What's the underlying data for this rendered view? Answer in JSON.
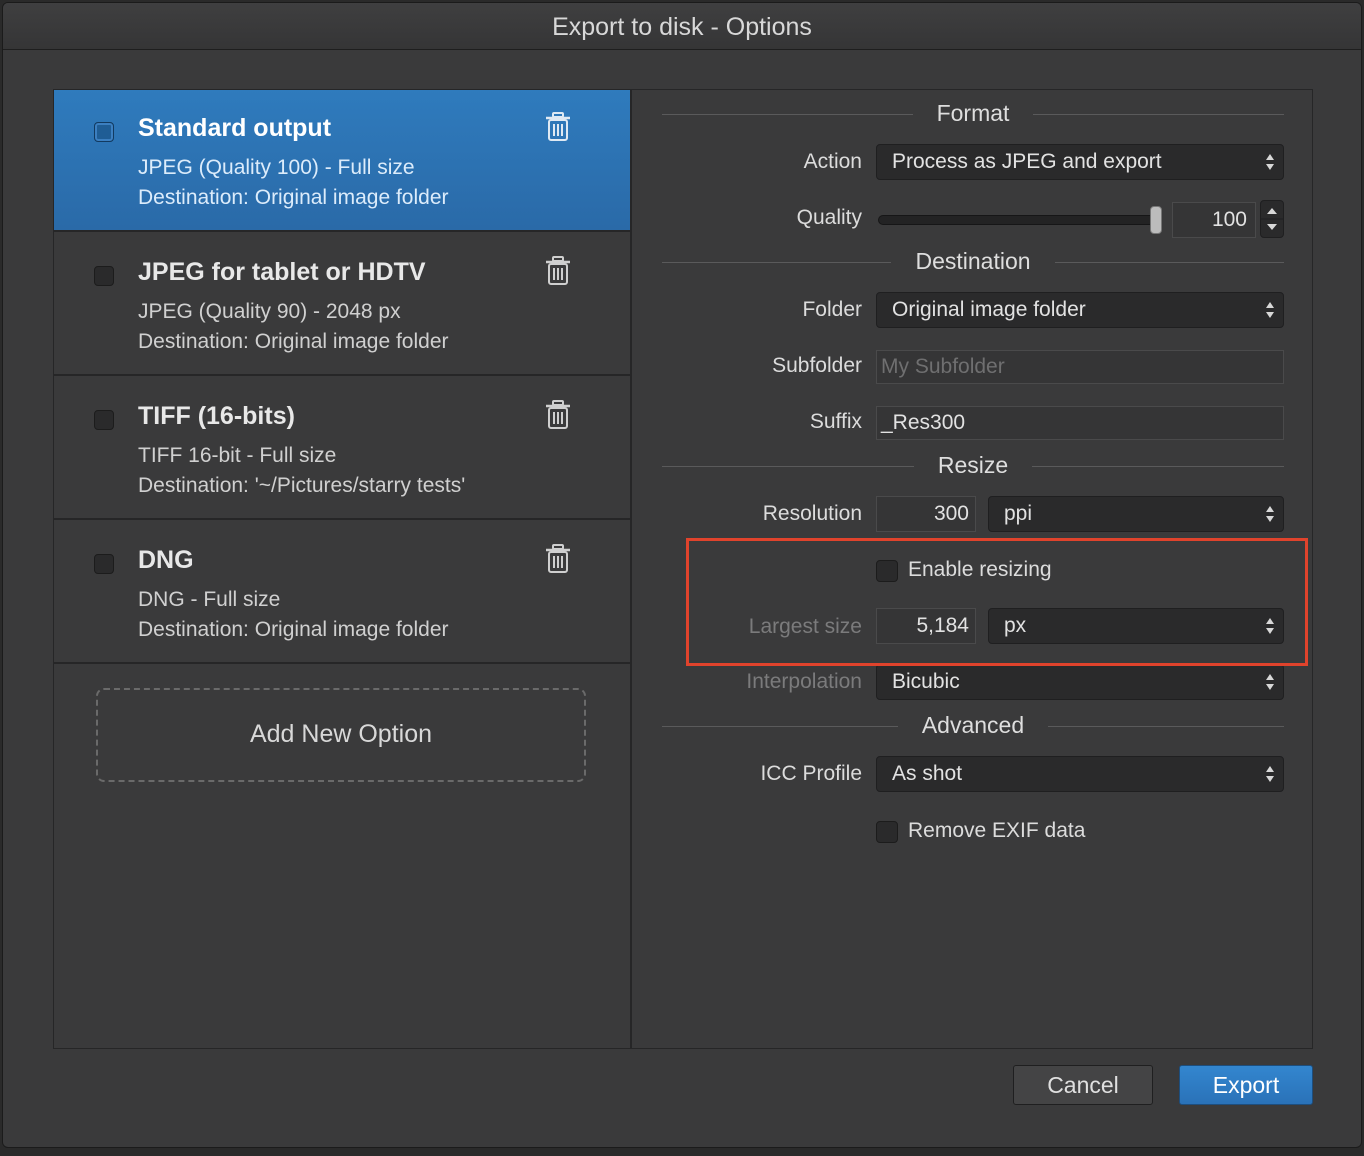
{
  "window": {
    "title": "Export to disk - Options"
  },
  "presets": [
    {
      "name": "Standard output",
      "line1": "JPEG (Quality 100) - Full size",
      "line2": "Destination: Original image folder",
      "selected": true
    },
    {
      "name": "JPEG for tablet or HDTV",
      "line1": "JPEG (Quality 90) - 2048 px",
      "line2": "Destination: Original image folder",
      "selected": false
    },
    {
      "name": "TIFF (16-bits)",
      "line1": "TIFF 16-bit - Full size",
      "line2": "Destination: '~/Pictures/starry tests'",
      "selected": false
    },
    {
      "name": "DNG",
      "line1": "DNG - Full size",
      "line2": "Destination: Original image folder",
      "selected": false
    }
  ],
  "add_option_label": "Add New Option",
  "format": {
    "heading": "Format",
    "action_label": "Action",
    "action_value": "Process as JPEG and export",
    "quality_label": "Quality",
    "quality_value": "100"
  },
  "destination": {
    "heading": "Destination",
    "folder_label": "Folder",
    "folder_value": "Original image folder",
    "subfolder_label": "Subfolder",
    "subfolder_placeholder": "My Subfolder",
    "suffix_label": "Suffix",
    "suffix_value": "_Res300"
  },
  "resize": {
    "heading": "Resize",
    "resolution_label": "Resolution",
    "resolution_value": "300",
    "resolution_unit": "ppi",
    "enable_resizing_label": "Enable resizing",
    "largest_size_label": "Largest size",
    "largest_size_value": "5,184",
    "largest_size_unit": "px",
    "interpolation_label": "Interpolation",
    "interpolation_value": "Bicubic"
  },
  "advanced": {
    "heading": "Advanced",
    "icc_label": "ICC Profile",
    "icc_value": "As shot",
    "remove_exif_label": "Remove EXIF data"
  },
  "buttons": {
    "cancel": "Cancel",
    "export": "Export"
  },
  "colors": {
    "accent": "#2f7bbd",
    "highlight": "#e0432c",
    "background": "#3a3a3b"
  },
  "icons": {
    "trash": "trash-icon",
    "popup_arrows": "updown-arrows-icon"
  }
}
